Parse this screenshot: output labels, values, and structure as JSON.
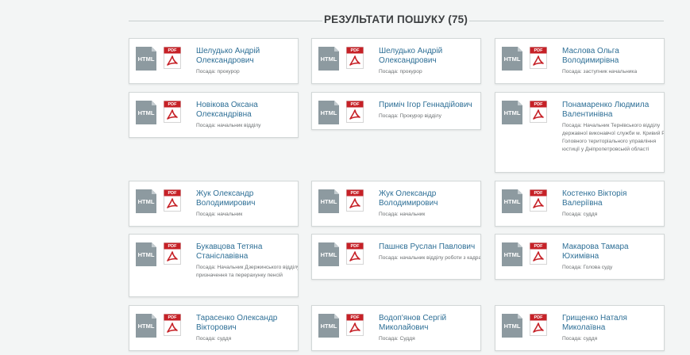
{
  "header": {
    "title": "РЕЗУЛЬТАТИ ПОШУКУ (75)"
  },
  "icons": {
    "html_label": "HTML",
    "pdf_label": "PDF"
  },
  "colors": {
    "name_link": "#2e6f96",
    "html_icon": "#8d9aa0",
    "pdf_icon": "#c62127"
  },
  "results": [
    {
      "name": "Шелудько Андрій Олександрович",
      "position": "Посада: прокурор"
    },
    {
      "name": "Шелудько Андрій Олександрович",
      "position": "Посада: прокурор"
    },
    {
      "name": "Маслова Ольга Володимирівна",
      "position": "Посада: заступник начальника"
    },
    {
      "name": "Новікова Оксана Олександрівна",
      "position": "Посада: начальник відділу"
    },
    {
      "name": "Приміч Ігор Геннадійович",
      "position": "Посада: Прокурор відділу"
    },
    {
      "name": "Понамаренко Людмила Валентинівна",
      "position": "Посада: Начальник Тернівського відділу державної виконавчої служби м. Кривий Ріг Головного територіального управління юстиції у Дніпропетровській області"
    },
    {
      "name": "Жук Олександр Володимирович",
      "position": "Посада: начальник"
    },
    {
      "name": "Жук Олександр Володимирович",
      "position": "Посада: начальник"
    },
    {
      "name": "Костенко Вікторія Валеріївна",
      "position": "Посада: суддя"
    },
    {
      "name": "Букавцова Тетяна Станіславівна",
      "position": "Посада: Начальник Дзержинського відділу з призначення та перерахунку пенсій"
    },
    {
      "name": "Пашнєв Руслан Павлович",
      "position": "Посада: начальник відділу роботи з кадрами"
    },
    {
      "name": "Макарова Тамара Юхимівна",
      "position": "Посада: Голова суду"
    },
    {
      "name": "Тарасенко Олександр Вікторович",
      "position": "Посада: суддя"
    },
    {
      "name": "Водоп'янов Сергій Миколайович",
      "position": "Посада: Суддя"
    },
    {
      "name": "Грищенко Наталя Миколаївна",
      "position": "Посада: суддя"
    }
  ]
}
